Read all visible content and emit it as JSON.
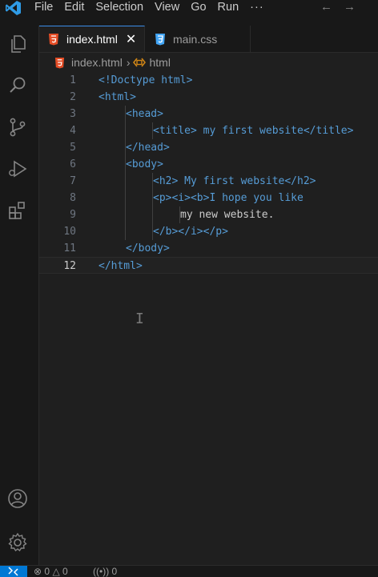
{
  "menu": {
    "items": [
      "File",
      "Edit",
      "Selection",
      "View",
      "Go",
      "Run"
    ],
    "more": "···"
  },
  "nav": {
    "back": "←",
    "forward": "→"
  },
  "tabs": [
    {
      "label": "index.html",
      "active": true,
      "close": "✕",
      "icon": "html5-file-icon"
    },
    {
      "label": "main.css",
      "active": false,
      "icon": "css3-file-icon"
    }
  ],
  "breadcrumb": {
    "file": "index.html",
    "separator": "›",
    "symbol": "html"
  },
  "editor": {
    "lines": [
      {
        "num": "1",
        "text": "<!Doctype html>"
      },
      {
        "num": "2",
        "text": "<html>"
      },
      {
        "num": "3",
        "text": "<head>"
      },
      {
        "num": "4",
        "text": "<title> my first website</title>"
      },
      {
        "num": "5",
        "text": "</head>"
      },
      {
        "num": "6",
        "text": "<body>"
      },
      {
        "num": "7",
        "text": "<h2> My first website</h2>"
      },
      {
        "num": "8",
        "text": "<p><i><b>I hope you like"
      },
      {
        "num": "9",
        "text": "my new website."
      },
      {
        "num": "10",
        "text": "</b></i></p>"
      },
      {
        "num": "11",
        "text": "</body>"
      },
      {
        "num": "12",
        "text": "</html>"
      }
    ],
    "current_line": "12"
  },
  "status": {
    "errors": "0",
    "warnings": "0",
    "ports": "0"
  },
  "colors": {
    "tag": "#569cd6",
    "text": "#cccccc",
    "accent": "#0078d4",
    "html_icon": "#e44d26",
    "css_icon": "#42a5f5"
  }
}
